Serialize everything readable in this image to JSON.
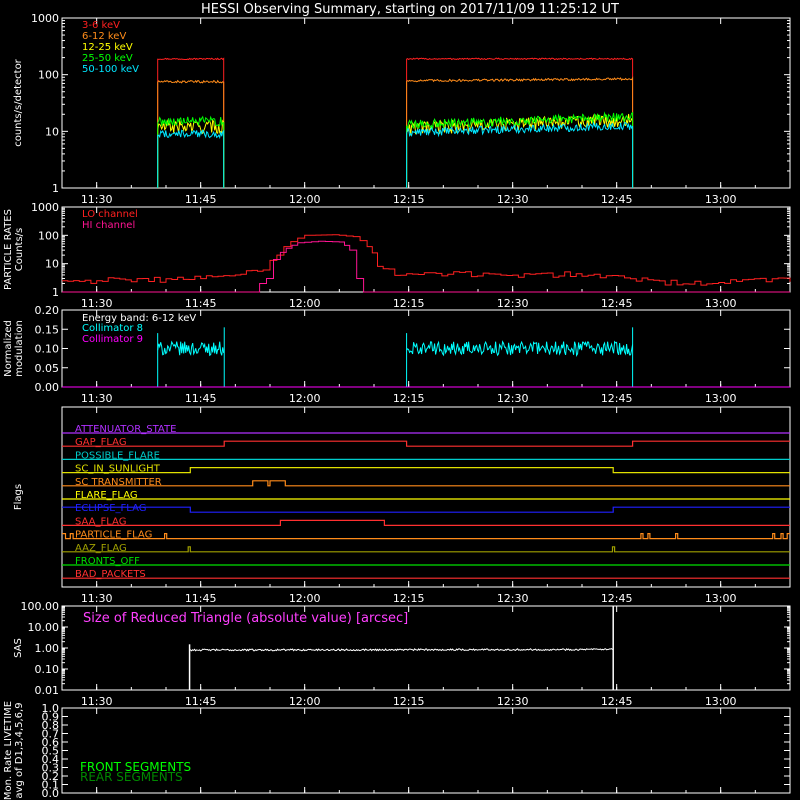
{
  "title": "HESSI Observing Summary, starting on 2017/11/09 11:25:12 UT",
  "time_axis": {
    "start_min": 685,
    "end_min": 790,
    "ticks": [
      {
        "min": 690,
        "label": "11:30"
      },
      {
        "min": 705,
        "label": "11:45"
      },
      {
        "min": 720,
        "label": "12:00"
      },
      {
        "min": 735,
        "label": "12:15"
      },
      {
        "min": 750,
        "label": "12:30"
      },
      {
        "min": 765,
        "label": "12:45"
      },
      {
        "min": 780,
        "label": "13:00"
      }
    ]
  },
  "chart_data": [
    {
      "type": "line",
      "ylabel": "counts/s/detector",
      "scale": "log",
      "ylim": [
        1,
        1000
      ],
      "yticks": [
        {
          "v": 1,
          "label": "1"
        },
        {
          "v": 10,
          "label": "10"
        },
        {
          "v": 100,
          "label": "100"
        },
        {
          "v": 1000,
          "label": "1000"
        }
      ],
      "legend_position": "top-left",
      "series": [
        {
          "name": "3-6 keV",
          "color": "#ff2020",
          "baseline": 1,
          "segments": [
            {
              "start": 698.8,
              "end": 708.4,
              "values": [
                190,
                190
              ]
            },
            {
              "start": 734.7,
              "end": 767.3,
              "values": [
                190,
                190
              ]
            }
          ]
        },
        {
          "name": "6-12 keV",
          "color": "#ff8c1a",
          "baseline": 1,
          "segments": [
            {
              "start": 698.8,
              "end": 708.4,
              "values": [
                75,
                75
              ]
            },
            {
              "start": 734.7,
              "end": 767.3,
              "values": [
                78,
                84
              ]
            }
          ]
        },
        {
          "name": "12-25 keV",
          "color": "#ffff00",
          "baseline": 1,
          "segments": [
            {
              "start": 698.8,
              "end": 708.4,
              "values": [
                12,
                12
              ]
            },
            {
              "start": 734.7,
              "end": 767.3,
              "values": [
                11,
                16
              ]
            }
          ]
        },
        {
          "name": "25-50 keV",
          "color": "#00ff00",
          "baseline": 1,
          "segments": [
            {
              "start": 698.8,
              "end": 708.4,
              "values": [
                15,
                15
              ]
            },
            {
              "start": 734.7,
              "end": 767.3,
              "values": [
                13,
                18
              ]
            }
          ]
        },
        {
          "name": "50-100 keV",
          "color": "#00e5ff",
          "baseline": 1,
          "segments": [
            {
              "start": 698.8,
              "end": 708.4,
              "values": [
                9,
                9
              ]
            },
            {
              "start": 734.7,
              "end": 767.3,
              "values": [
                9.5,
                12.5
              ]
            }
          ]
        }
      ]
    },
    {
      "type": "line",
      "ylabel": "PARTICLE RATES\nCounts/s",
      "scale": "log",
      "ylim": [
        1,
        1000
      ],
      "yticks": [
        {
          "v": 1,
          "label": "1"
        },
        {
          "v": 10,
          "label": "10"
        },
        {
          "v": 100,
          "label": "100"
        },
        {
          "v": 1000,
          "label": "1000"
        }
      ],
      "legend_position": "top-left",
      "series": [
        {
          "name": "LO channel",
          "color": "#ff2020",
          "points": [
            [
              685,
              2.5
            ],
            [
              695,
              2.5
            ],
            [
              705,
              3
            ],
            [
              710,
              4
            ],
            [
              714,
              6
            ],
            [
              716,
              20
            ],
            [
              718,
              60
            ],
            [
              720,
              100
            ],
            [
              724,
              105
            ],
            [
              727,
              90
            ],
            [
              729,
              40
            ],
            [
              730.5,
              8
            ],
            [
              733,
              4
            ],
            [
              750,
              4
            ],
            [
              760,
              4
            ],
            [
              767,
              3
            ],
            [
              772,
              2
            ],
            [
              790,
              2.5
            ]
          ]
        },
        {
          "name": "HI channel",
          "color": "#ff1493",
          "points": [
            [
              685,
              1
            ],
            [
              712.5,
              1
            ],
            [
              714.5,
              3
            ],
            [
              716.5,
              25
            ],
            [
              719,
              55
            ],
            [
              722,
              62
            ],
            [
              725,
              58
            ],
            [
              726.5,
              30
            ],
            [
              727.5,
              3
            ],
            [
              728.5,
              1
            ],
            [
              790,
              1
            ]
          ]
        }
      ]
    },
    {
      "type": "line",
      "ylabel": "Normalized\nmodulation",
      "scale": "linear",
      "ylim": [
        0,
        0.2
      ],
      "yticks": [
        {
          "v": 0,
          "label": "0.00"
        },
        {
          "v": 0.05,
          "label": "0.05"
        },
        {
          "v": 0.1,
          "label": "0.10"
        },
        {
          "v": 0.15,
          "label": "0.15"
        },
        {
          "v": 0.2,
          "label": "0.20"
        }
      ],
      "annotation": "Energy band: 6-12 keV",
      "series": [
        {
          "name": "Collimator 8",
          "color": "#00ffff",
          "segments": [
            {
              "start": 698.8,
              "end": 708.4,
              "values": [
                0.1,
                0.1
              ]
            },
            {
              "start": 734.7,
              "end": 767.3,
              "values": [
                0.1,
                0.1
              ]
            }
          ]
        },
        {
          "name": "Collimator 9",
          "color": "#ff00ff",
          "points": [
            [
              685,
              0
            ],
            [
              790,
              0
            ]
          ]
        }
      ]
    },
    {
      "type": "line",
      "ylabel": "Flags",
      "flags": [
        {
          "name": "ATTENUATOR_STATE",
          "color": "#b030ff",
          "steps": [
            [
              685,
              0
            ]
          ]
        },
        {
          "name": "GAP_FLAG",
          "color": "#ff3030",
          "steps": [
            [
              685,
              0
            ],
            [
              708.4,
              1
            ],
            [
              734.7,
              0
            ],
            [
              767.3,
              1
            ]
          ]
        },
        {
          "name": "POSSIBLE_FLARE",
          "color": "#00cccc",
          "steps": [
            [
              685,
              0
            ]
          ]
        },
        {
          "name": "SC_IN_SUNLIGHT",
          "color": "#e0e000",
          "steps": [
            [
              685,
              0
            ],
            [
              703.5,
              1
            ],
            [
              764.5,
              0
            ]
          ]
        },
        {
          "name": "SC TRANSMITTER",
          "color": "#ff8c1a",
          "steps": [
            [
              685,
              0
            ],
            [
              712.5,
              1
            ],
            [
              714.7,
              0
            ],
            [
              715,
              1
            ],
            [
              717.2,
              0
            ]
          ]
        },
        {
          "name": "FLARE_FLAG",
          "color": "#ffff00",
          "steps": [
            [
              685,
              0
            ]
          ]
        },
        {
          "name": "ECLIPSE_FLAG",
          "color": "#2020ff",
          "steps": [
            [
              685,
              1
            ],
            [
              703.5,
              0
            ],
            [
              764.5,
              1
            ]
          ]
        },
        {
          "name": "SAA_FLAG",
          "color": "#ff3030",
          "steps": [
            [
              685,
              0
            ],
            [
              716.5,
              1
            ],
            [
              731.5,
              0
            ]
          ]
        },
        {
          "name": "PARTICLE_FLAG",
          "color": "#ff8c1a",
          "steps": [
            [
              685,
              1
            ],
            [
              685.5,
              0
            ],
            [
              686.2,
              1
            ],
            [
              686.6,
              0
            ],
            [
              699.8,
              1
            ],
            [
              700.1,
              0
            ],
            [
              768.5,
              1
            ],
            [
              768.8,
              0
            ],
            [
              769.5,
              1
            ],
            [
              769.8,
              0
            ],
            [
              773.5,
              1
            ],
            [
              773.8,
              0
            ],
            [
              787.5,
              1
            ],
            [
              787.8,
              0
            ],
            [
              788.7,
              1
            ],
            [
              789,
              0
            ],
            [
              789.6,
              1
            ]
          ]
        },
        {
          "name": "AAZ_FLAG",
          "color": "#a0a000",
          "steps": [
            [
              685,
              0
            ],
            [
              703.2,
              1
            ],
            [
              703.5,
              0
            ],
            [
              764.4,
              1
            ],
            [
              764.7,
              0
            ]
          ]
        },
        {
          "name": "FRONTS_OFF",
          "color": "#00e000",
          "steps": [
            [
              685,
              0
            ]
          ]
        },
        {
          "name": "BAD_PACKETS",
          "color": "#ff3030",
          "steps": [
            [
              685,
              0
            ]
          ]
        }
      ]
    },
    {
      "type": "line",
      "ylabel": "SAS",
      "scale": "log",
      "ylim": [
        0.01,
        100
      ],
      "yticks": [
        {
          "v": 0.01,
          "label": "0.01"
        },
        {
          "v": 0.1,
          "label": "0.10"
        },
        {
          "v": 1,
          "label": "1.00"
        },
        {
          "v": 10,
          "label": "10.00"
        },
        {
          "v": 100,
          "label": "100.00"
        }
      ],
      "annotation": "Size of Reduced Triangle (absolute value) [arcsec]",
      "series": [
        {
          "name": "",
          "color": "#ffffff",
          "segments": [
            {
              "start": 703.4,
              "end": 764.5,
              "values": [
                0.8,
                0.85
              ]
            }
          ]
        }
      ]
    },
    {
      "type": "line",
      "ylabel": "Mon. Rate LIVETIME\navg of D1,3,4,5,6,9",
      "scale": "linear",
      "ylim": [
        0,
        1
      ],
      "yticks": [
        {
          "v": 0,
          "label": "0.0"
        },
        {
          "v": 0.1,
          "label": "0.1"
        },
        {
          "v": 0.2,
          "label": "0.2"
        },
        {
          "v": 0.3,
          "label": "0.3"
        },
        {
          "v": 0.4,
          "label": "0.4"
        },
        {
          "v": 0.5,
          "label": "0.5"
        },
        {
          "v": 0.6,
          "label": "0.6"
        },
        {
          "v": 0.7,
          "label": "0.7"
        },
        {
          "v": 0.8,
          "label": "0.8"
        },
        {
          "v": 0.9,
          "label": "0.9"
        },
        {
          "v": 1,
          "label": "1.0"
        }
      ],
      "legend_position": "bottom-left",
      "series": [
        {
          "name": "FRONT SEGMENTS",
          "color": "#00ff00",
          "points": []
        },
        {
          "name": "REAR SEGMENTS",
          "color": "#008800",
          "points": []
        }
      ]
    }
  ]
}
